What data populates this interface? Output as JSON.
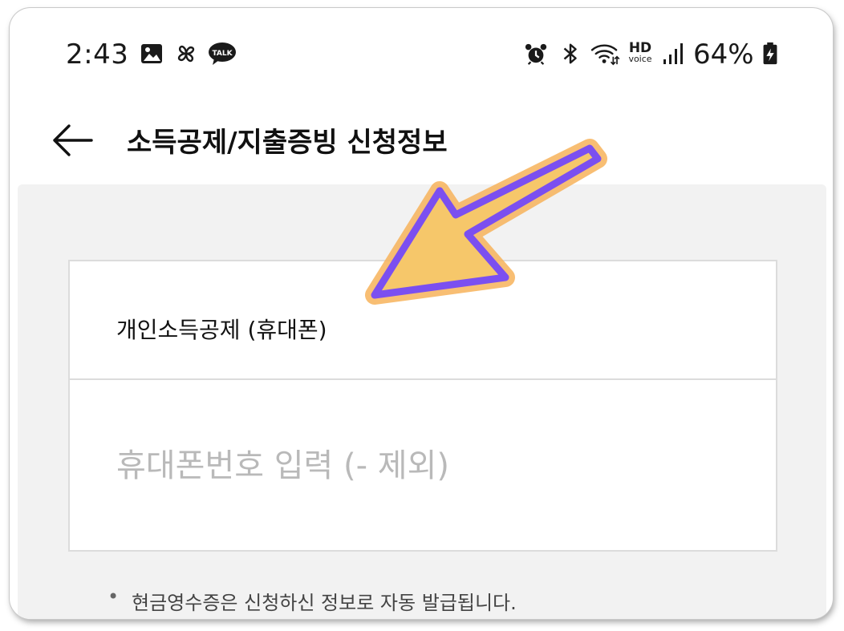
{
  "status_bar": {
    "time": "2:43",
    "left_icons": [
      "gallery-icon",
      "pinwheel-icon",
      "kakaotalk-icon"
    ],
    "kakaotalk_badge": "TALK",
    "right_icons": [
      "alarm-icon",
      "bluetooth-icon",
      "wifi-icon",
      "hd-voice-icon",
      "signal-icon",
      "battery-charging-icon"
    ],
    "hd_label": "HD",
    "voice_label": "voice",
    "battery_percent": "64%"
  },
  "header": {
    "back_icon": "back-arrow-icon",
    "title": "소득공제/지출증빙 신청정보"
  },
  "form": {
    "deduction_type": "개인소득공제 (휴대폰)",
    "phone_placeholder": "휴대폰번호 입력 (- 제외)",
    "phone_value": ""
  },
  "notice": {
    "bullet": "•",
    "text": "현금영수증은 신청하신 정보로 자동 발급됩니다."
  },
  "annotation": {
    "arrow_icon": "pointer-arrow-icon",
    "fill_color": "#f6c76a",
    "outline_color": "#7b4ff0",
    "glow_color": "#f7b35a"
  },
  "colors": {
    "background": "#f2f2f2",
    "card_border": "#dcdcdc",
    "placeholder": "#b9b9b9",
    "title": "#111111"
  }
}
